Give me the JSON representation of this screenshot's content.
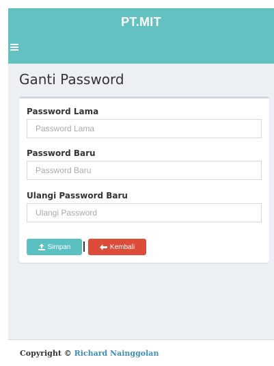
{
  "header": {
    "brand": "PT.MIT",
    "color": "#63c2c1"
  },
  "page": {
    "title": "Ganti Password"
  },
  "form": {
    "old_password": {
      "label": "Password Lama",
      "placeholder": "Password Lama",
      "value": ""
    },
    "new_password": {
      "label": "Password Baru",
      "placeholder": "Password Baru",
      "value": ""
    },
    "repeat_password": {
      "label": "Ulangi Password Baru",
      "placeholder": "Ulangi Password",
      "value": ""
    },
    "save_label": "Simpan",
    "back_label": "Kembali",
    "icons": {
      "save": "upload-icon",
      "back": "arrow-left-icon"
    }
  },
  "colors": {
    "save_button": "#5bc0c1",
    "back_button": "#dd4b39",
    "background": "#ecf0f5",
    "link": "#3c8dbc"
  },
  "footer": {
    "copyright": "Copyright ©",
    "author": "Richard Nainggolan"
  }
}
